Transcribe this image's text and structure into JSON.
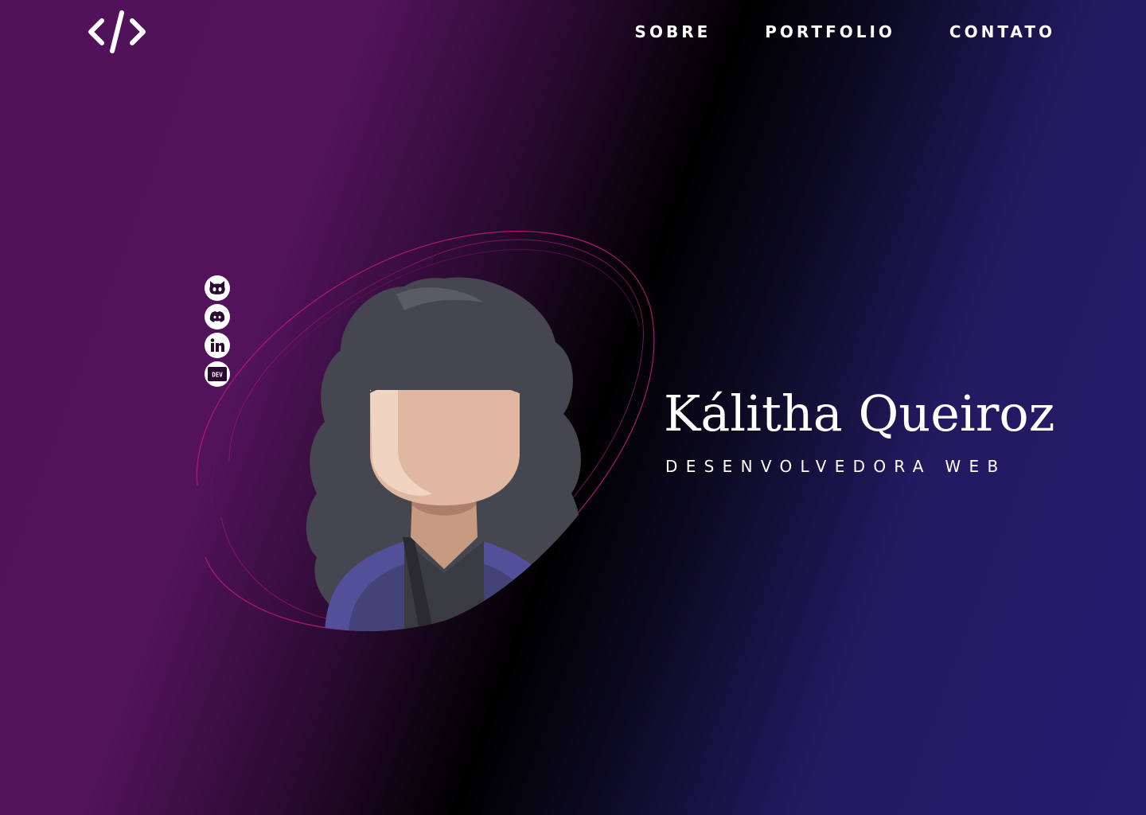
{
  "logo": {
    "icon": "code-brackets-icon"
  },
  "nav": {
    "items": [
      {
        "label": "SOBRE"
      },
      {
        "label": "PORTFOLIO"
      },
      {
        "label": "CONTATO"
      }
    ]
  },
  "socials": [
    {
      "icon": "github-icon"
    },
    {
      "icon": "discord-icon"
    },
    {
      "icon": "linkedin-icon"
    },
    {
      "icon": "dev-icon",
      "label": "DEV"
    }
  ],
  "hero": {
    "name": "Kálitha Queiroz",
    "role": "DESENVOLVEDORA WEB"
  },
  "colors": {
    "purple": "#52135b",
    "black": "#000000",
    "indigo": "#251c6b",
    "accent_line": "#c0187a"
  }
}
